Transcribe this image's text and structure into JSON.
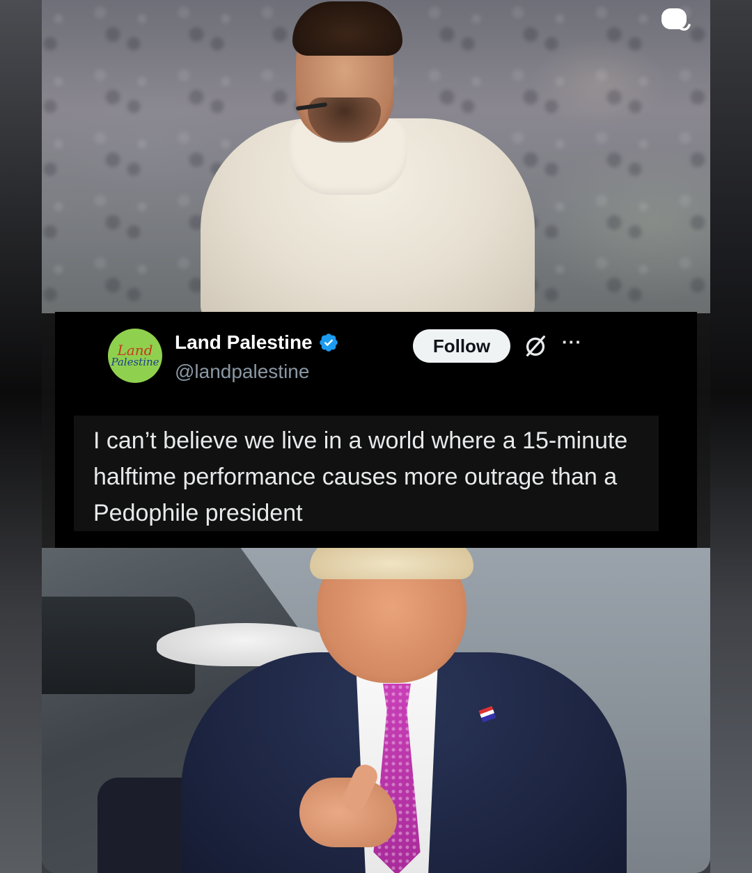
{
  "post": {
    "author": {
      "display_name": "Land Palestine",
      "handle": "@landpalestine",
      "verified": true,
      "avatar_text_line1": "Land",
      "avatar_text_line2": "Palestine"
    },
    "follow_label": "Follow",
    "body": "I can’t believe we live in a world where a 15-minute halftime performance causes more outrage than a Pedophile president",
    "more_label": "···"
  },
  "icons": {
    "verified": "verified-badge-icon",
    "grok": "grok-icon",
    "more": "more-options-icon",
    "chat": "chat-bubble-icon"
  },
  "colors": {
    "tweet_background": "#000000",
    "verified_blue": "#1d9bf0",
    "handle_gray": "#8b98a5",
    "text_primary": "#e7e9ea",
    "avatar_green": "#8fd14f"
  }
}
